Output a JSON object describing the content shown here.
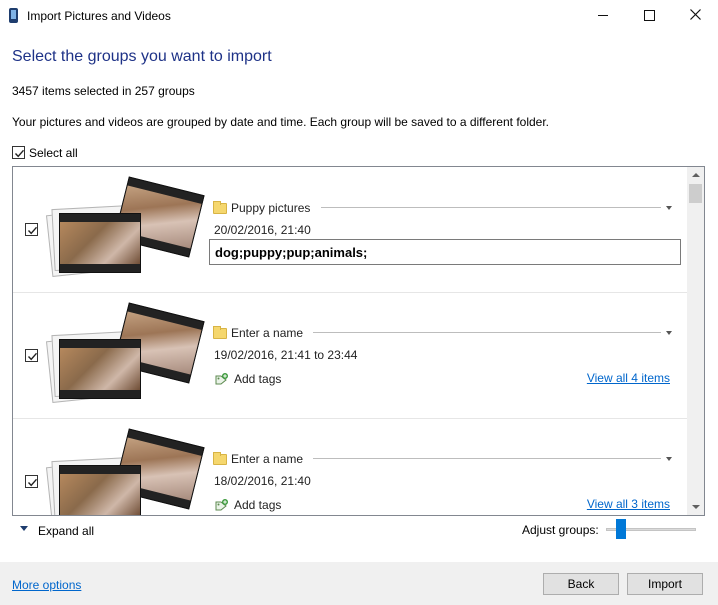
{
  "window": {
    "title": "Import Pictures and Videos"
  },
  "heading": "Select the groups you want to import",
  "summary": "3457 items selected in 257 groups",
  "description": "Your pictures and videos are grouped by date and time. Each group will be saved to a different folder.",
  "select_all": {
    "label": "Select all",
    "checked": true
  },
  "groups": [
    {
      "checked": true,
      "name": "Puppy pictures",
      "date": "20/02/2016, 21:40",
      "tags_value": "dog;puppy;pup;animals;"
    },
    {
      "checked": true,
      "name_placeholder": "Enter a name",
      "date": "19/02/2016, 21:41 to 23:44",
      "add_tags_label": "Add tags",
      "view_all_label": "View all 4 items"
    },
    {
      "checked": true,
      "name_placeholder": "Enter a name",
      "date": "18/02/2016, 21:40",
      "add_tags_label": "Add tags",
      "view_all_label": "View all 3 items"
    }
  ],
  "expand_all_label": "Expand all",
  "adjust_groups": {
    "label": "Adjust groups:",
    "level": 0.12
  },
  "footer": {
    "more_options_label": "More options",
    "back_label": "Back",
    "import_label": "Import"
  },
  "icons": {
    "app": "phone-icon",
    "folder": "folder-icon",
    "tag": "tag-add-icon",
    "dropdown": "chevron-down-icon"
  },
  "colors": {
    "heading": "#1e3287",
    "link": "#0066cc",
    "slider_accent": "#0078d7",
    "folder": "#f5d76e"
  }
}
